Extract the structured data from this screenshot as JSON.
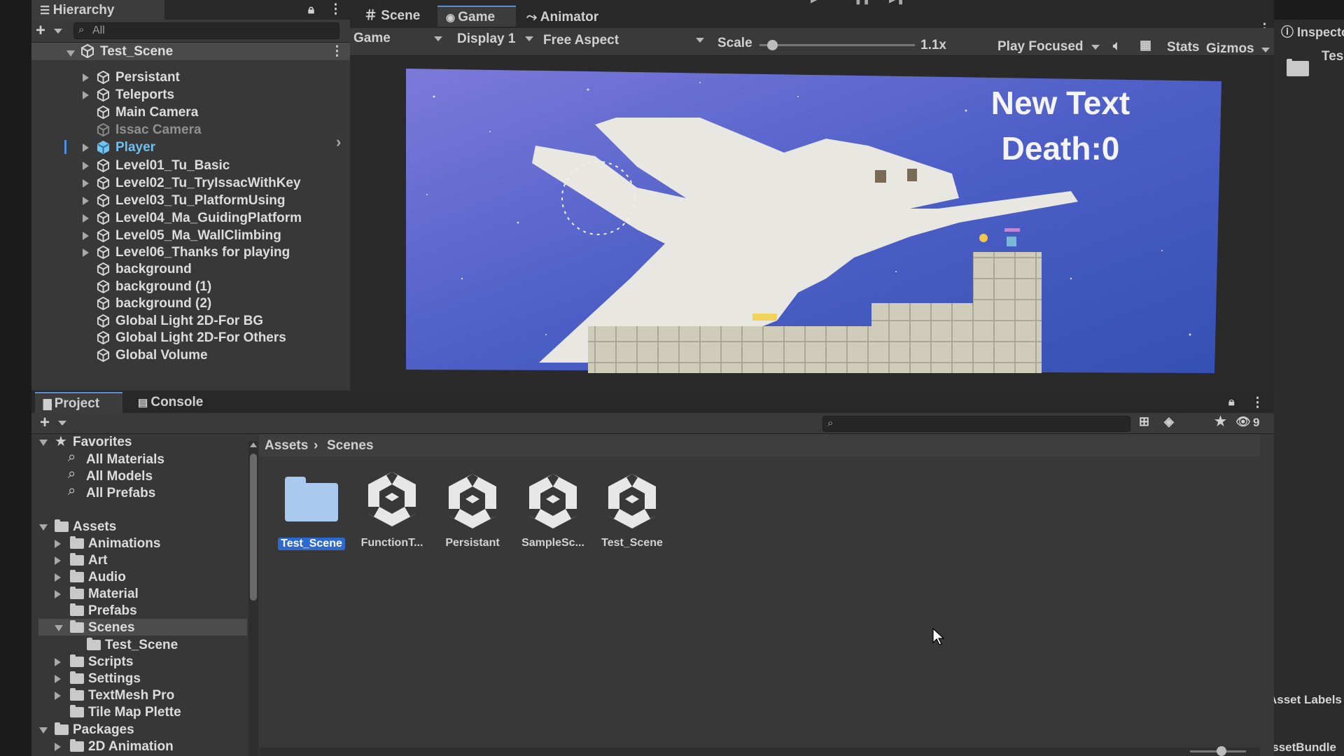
{
  "hierarchy": {
    "tab_label": "Hierarchy",
    "search_placeholder": "All",
    "scene_name": "Test_Scene",
    "items": [
      {
        "label": "Persistant",
        "foldout": "closed"
      },
      {
        "label": "Teleports",
        "foldout": "closed"
      },
      {
        "label": "Main Camera",
        "foldout": "none"
      },
      {
        "label": "Issac Camera",
        "foldout": "none",
        "disabled": true
      },
      {
        "label": "Player",
        "foldout": "closed",
        "selected": true
      },
      {
        "label": "Level01_Tu_Basic",
        "foldout": "closed"
      },
      {
        "label": "Level02_Tu_TryIssacWithKey",
        "foldout": "closed"
      },
      {
        "label": "Level03_Tu_PlatformUsing",
        "foldout": "closed"
      },
      {
        "label": "Level04_Ma_GuidingPlatform",
        "foldout": "closed"
      },
      {
        "label": "Level05_Ma_WallClimbing",
        "foldout": "closed"
      },
      {
        "label": "Level06_Thanks for playing",
        "foldout": "closed"
      },
      {
        "label": "background",
        "foldout": "none"
      },
      {
        "label": "background (1)",
        "foldout": "none"
      },
      {
        "label": "background (2)",
        "foldout": "none"
      },
      {
        "label": "Global Light 2D-For BG",
        "foldout": "none"
      },
      {
        "label": "Global Light 2D-For Others",
        "foldout": "none"
      },
      {
        "label": "Global Volume",
        "foldout": "none"
      }
    ]
  },
  "view_tabs": {
    "scene": "Scene",
    "game": "Game",
    "animator": "Animator"
  },
  "game_toolbar": {
    "view_mode": "Game",
    "display": "Display 1",
    "aspect": "Free Aspect",
    "scale_label": "Scale",
    "scale_value": "1.1x",
    "scale_fraction": 0.05,
    "play_mode": "Play Focused",
    "stats": "Stats",
    "gizmos": "Gizmos"
  },
  "game_view": {
    "ui_text": "New Text",
    "death_counter": "Death:0",
    "colors": {
      "sky_top": "#6e6fd1",
      "sky_bottom": "#3d52b8",
      "ghost": "#e8e6e1",
      "tiles": "#c9c8b4"
    }
  },
  "inspector": {
    "tab_label": "Inspecto",
    "item_label": "Tes",
    "asset_labels": "Asset Labels",
    "asset_bundle": "AssetBundle"
  },
  "project": {
    "tab_project": "Project",
    "tab_console": "Console",
    "hidden_packages_count": "9",
    "breadcrumb": [
      "Assets",
      "Scenes"
    ],
    "favorites_label": "Favorites",
    "favorites": [
      "All Materials",
      "All Models",
      "All Prefabs"
    ],
    "assets_label": "Assets",
    "asset_folders": [
      {
        "label": "Animations",
        "foldout": "closed"
      },
      {
        "label": "Art",
        "foldout": "closed"
      },
      {
        "label": "Audio",
        "foldout": "closed"
      },
      {
        "label": "Material",
        "foldout": "closed"
      },
      {
        "label": "Prefabs",
        "foldout": "none"
      },
      {
        "label": "Scenes",
        "foldout": "open",
        "selected": true
      },
      {
        "label": "Test_Scene",
        "foldout": "none",
        "child": true
      },
      {
        "label": "Scripts",
        "foldout": "closed"
      },
      {
        "label": "Settings",
        "foldout": "closed"
      },
      {
        "label": "TextMesh Pro",
        "foldout": "closed"
      },
      {
        "label": "Tile Map Plette",
        "foldout": "none"
      }
    ],
    "packages_label": "Packages",
    "packages": [
      "2D Animation"
    ],
    "grid_items": [
      {
        "label": "Test_Scene",
        "type": "folder",
        "selected": true
      },
      {
        "label": "FunctionT...",
        "type": "scene"
      },
      {
        "label": "Persistant",
        "type": "scene"
      },
      {
        "label": "SampleSc...",
        "type": "scene"
      },
      {
        "label": "Test_Scene",
        "type": "scene"
      }
    ]
  },
  "theme": {
    "accent": "#2d6ad0",
    "panel_bg": "#383838",
    "selection": "#4c4c4c"
  }
}
